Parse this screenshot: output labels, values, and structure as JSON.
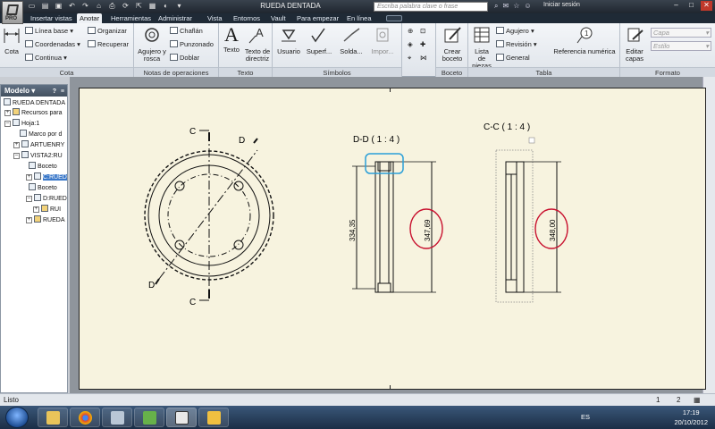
{
  "window": {
    "title": "RUEDA DENTADA",
    "app_badge": "PRO",
    "search_placeholder": "Escriba palabra clave o frase",
    "signin": "Iniciar sesión"
  },
  "tabs": [
    "Insertar vistas",
    "Anotar",
    "Herramientas",
    "Administrar",
    "Vista",
    "Entornos",
    "Vault",
    "Para empezar",
    "En línea"
  ],
  "ribbon": {
    "cota": {
      "title": "Cota",
      "big": "Cota",
      "items": [
        "Línea base",
        "Coordenadas",
        "Continua"
      ],
      "items2": [
        "Organizar",
        "Recuperar"
      ]
    },
    "notas": {
      "title": "Notas de operaciones",
      "big": "Agujero y rosca",
      "items": [
        "Chaflán",
        "Punzonado",
        "Doblar"
      ]
    },
    "texto": {
      "title": "Texto",
      "big1": "Texto",
      "big2": "Texto de directriz"
    },
    "simbolos": {
      "title": "Símbolos",
      "items": [
        "Usuario",
        "Superf...",
        "Solda...",
        "Impor..."
      ]
    },
    "boceto": {
      "title": "Boceto",
      "big": "Crear boceto"
    },
    "tabla": {
      "title": "Tabla",
      "big": "Lista de piezas",
      "items": [
        "Agujero",
        "Revisión",
        "General"
      ],
      "ref": "Referencia numérica"
    },
    "formato": {
      "title": "Formato",
      "big": "Editar capas",
      "style1": "Capa",
      "style2": "Estilo"
    }
  },
  "browser": {
    "title": "Modelo",
    "nodes": [
      "RUEDA DENTADA",
      "Recursos para",
      "Hoja:1",
      "Marco por d",
      "ARTUENRY",
      "VISTA2:RU",
      "Boceto",
      "C:RUED",
      "Boceto",
      "D:RUED",
      "RUI",
      "RUEDA"
    ]
  },
  "drawing": {
    "section_c": "C",
    "section_d": "D",
    "view1_title": "D-D ( 1 : 4 )",
    "view2_title": "C-C ( 1 : 4 )",
    "dim_334": "334,35",
    "dim_347": "347,69",
    "dim_348": "348,00"
  },
  "status": {
    "text": "Listo",
    "page1": "1",
    "page2": "2"
  },
  "taskbar": {
    "lang": "ES",
    "time": "17:19",
    "date": "20/10/2012"
  },
  "colors": {
    "sheet": "#f7f3df",
    "highlight_red": "#c8102e",
    "highlight_blue": "#2a9fd8"
  }
}
